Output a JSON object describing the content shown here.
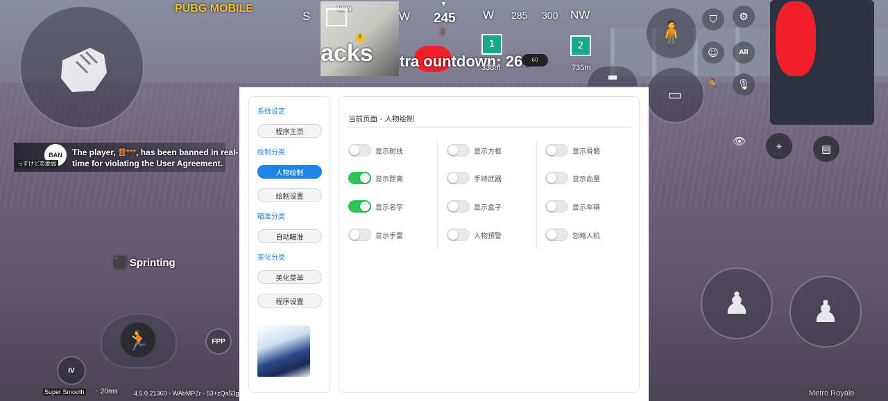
{
  "game_hud": {
    "compass": {
      "heading": "245",
      "labels": [
        "S",
        "W",
        "285",
        "300",
        "NW",
        "W"
      ],
      "marker": "3"
    },
    "new_badge": "NEW",
    "player_tag": "acks",
    "countdown_text": "tra  ountdown: 26s",
    "dist_left": "338m",
    "dist_right": "735m",
    "small_badge": "60",
    "exit_left_label": "1",
    "exit_right_label": "2",
    "brand_text": "PUBG MOBILE",
    "ban_title": "BAN",
    "ban_message_line1": "The player,",
    "ban_player": "昔***",
    "ban_message_line1b": ", has been banned in real-",
    "ban_message_line2": "time for violating the User Agreement.",
    "ban_subtag": "っすけど恋愛弱",
    "sprinting_label": "Sprinting",
    "fpp_label": "FPP",
    "level_label": "IV",
    "graphics_label": "Super Smooth",
    "ping_label": "20ms",
    "build_label": "4.5.0.21360 - WAbMPZr - 53+zQa53g",
    "map_name": "Metro Royale",
    "all_label": "All",
    "icons": {
      "fist": "fist-icon",
      "settings": "gear-icon",
      "shield": "shield-icon",
      "emote": "smile-icon",
      "mic": "mic-icon",
      "eye": "eye-icon",
      "location": "location-pin-icon",
      "chat": "chat-icon",
      "sprint": "running-man-icon",
      "crouch": "crouch-icon",
      "prone": "prone-icon",
      "lean_left": "lean-left-icon",
      "lean_right": "lean-right-icon"
    }
  },
  "menu": {
    "sidebar": {
      "sections": [
        {
          "title": "系统设定",
          "items": [
            {
              "label": "程序主页",
              "active": false
            }
          ]
        },
        {
          "title": "绘制分类",
          "items": [
            {
              "label": "人物绘制",
              "active": true
            },
            {
              "label": "绘制设置",
              "active": false
            }
          ]
        },
        {
          "title": "瞄准分类",
          "items": [
            {
              "label": "自动瞄准",
              "active": false
            }
          ]
        },
        {
          "title": "美化分类",
          "items": [
            {
              "label": "美化菜单",
              "active": false
            },
            {
              "label": "程序设置",
              "active": false
            }
          ]
        }
      ]
    },
    "page_title": "当前页面 - 人物绘制",
    "toggles": [
      [
        {
          "label": "显示射线",
          "on": false
        },
        {
          "label": "显示距离",
          "on": true
        },
        {
          "label": "显示名字",
          "on": true
        },
        {
          "label": "显示手雷",
          "on": false
        }
      ],
      [
        {
          "label": "显示方框",
          "on": false
        },
        {
          "label": "手持武器",
          "on": false
        },
        {
          "label": "显示盒子",
          "on": false
        },
        {
          "label": "人物预警",
          "on": false
        }
      ],
      [
        {
          "label": "显示骨骼",
          "on": false
        },
        {
          "label": "显示血量",
          "on": false
        },
        {
          "label": "显示车辆",
          "on": false
        },
        {
          "label": "忽略人机",
          "on": false
        }
      ]
    ],
    "colors": {
      "accent": "#1f84ea",
      "toggle_on": "#30c552",
      "toggle_off": "#e7e8ea"
    }
  }
}
